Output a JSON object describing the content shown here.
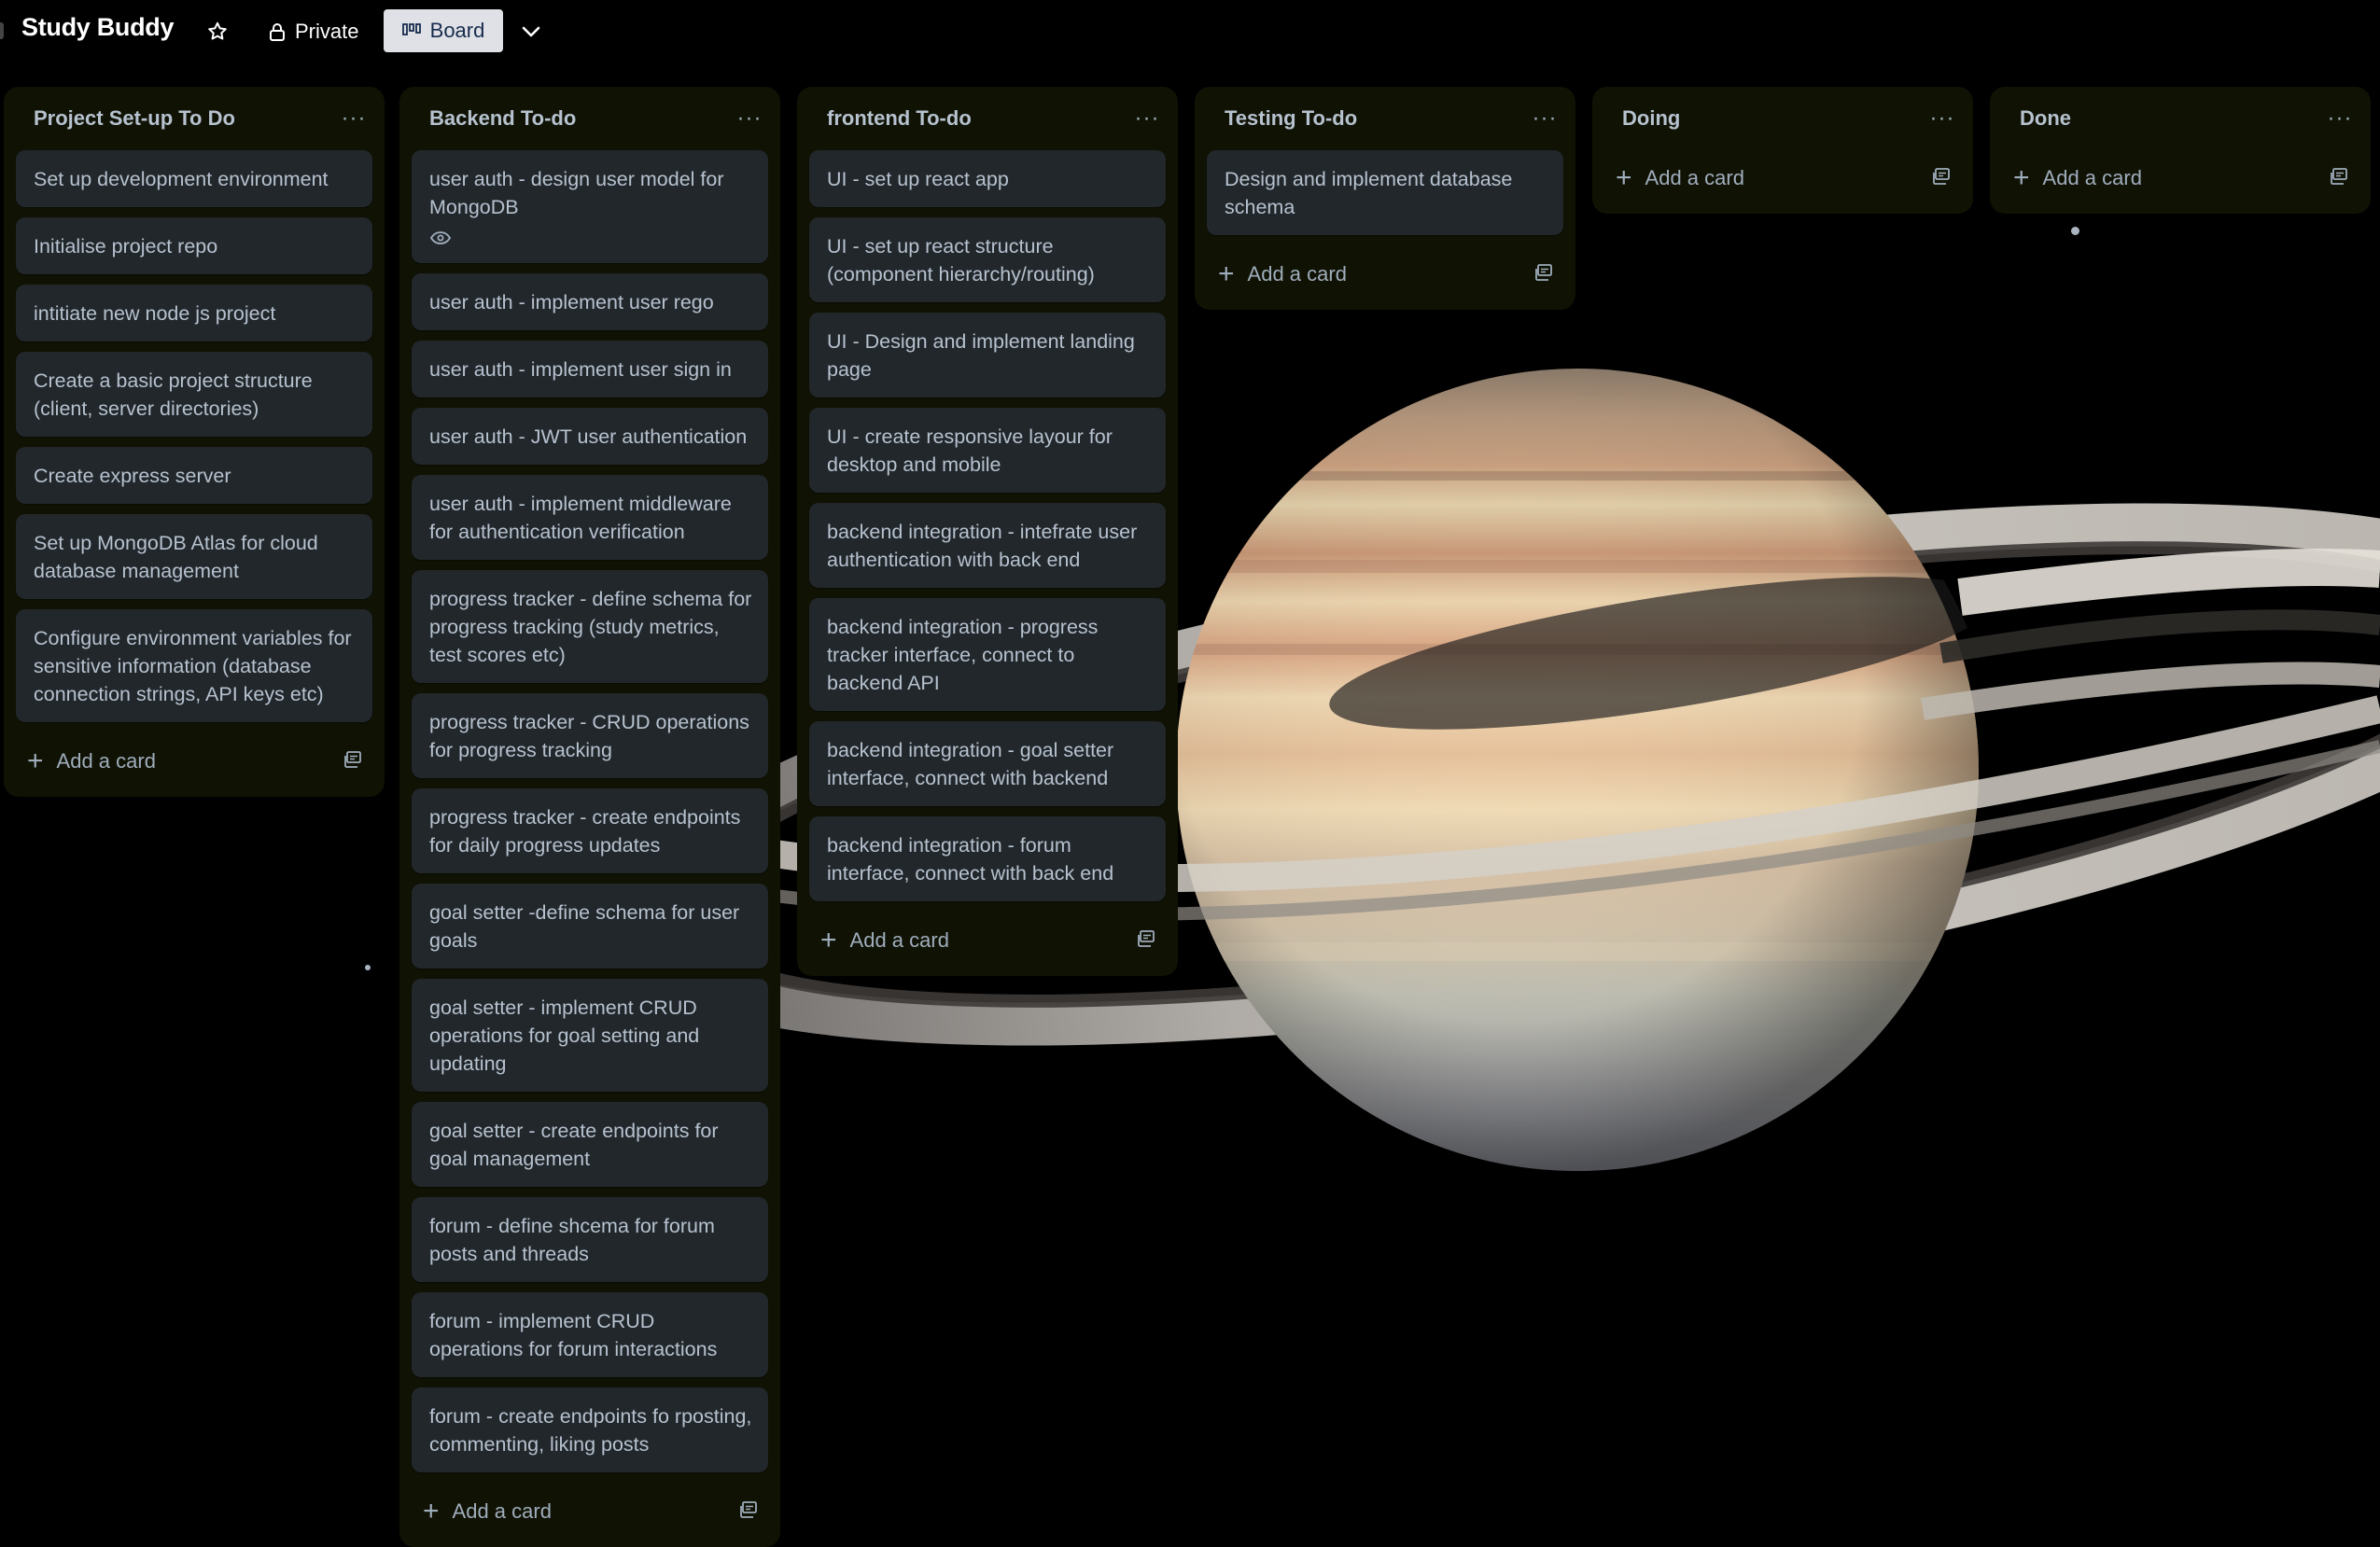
{
  "header": {
    "title": "Study Buddy",
    "visibility_label": "Private",
    "view_label": "Board"
  },
  "icons": {
    "star": "star-icon",
    "lock": "lock-icon",
    "board": "board-icon",
    "chevron": "chevron-down-icon",
    "menu": "more-icon",
    "plus": "plus-icon",
    "template": "card-template-icon",
    "watch": "eye-icon"
  },
  "colors": {
    "list_bg": "#101204",
    "card_bg": "#22272b",
    "text": "#b6c2cf",
    "board_button_bg": "#dfe1e6"
  },
  "add_card_label": "Add a card",
  "menu_glyph": "···",
  "lists": [
    {
      "title": "Project Set-up To Do",
      "cards": [
        "Set up development environment",
        "Initialise project repo",
        "intitiate new node js project",
        "Create a basic project structure (client, server directories)",
        "Create express server",
        "Set up MongoDB Atlas for cloud database management",
        "Configure environment variables for sensitive information (database connection strings, API keys etc)"
      ]
    },
    {
      "title": "Backend To-do",
      "cards": [
        "user auth - design user model for MongoDB",
        "user auth - implement user rego",
        "user auth - implement user sign in",
        "user auth - JWT user authentication",
        "user auth - implement middleware for authentication verification",
        "progress tracker - define schema for progress tracking (study metrics, test scores etc)",
        "progress tracker - CRUD operations for progress tracking",
        "progress tracker - create endpoints for daily progress updates",
        "goal setter -define schema for user goals",
        "goal setter - implement CRUD operations for goal setting and updating",
        "goal setter - create endpoints for goal management",
        "forum - define shcema for forum posts and threads",
        "forum - implement CRUD operations for forum interactions",
        "forum - create endpoints fo rposting, commenting, liking posts"
      ]
    },
    {
      "title": "frontend To-do",
      "cards": [
        "UI - set up react app",
        "UI - set up react structure (component hierarchy/routing)",
        "UI - Design and implement landing page",
        "UI - create responsive layour for desktop and mobile",
        "backend integration - intefrate user authentication with back end",
        "backend integration - progress tracker interface, connect to backend API",
        "backend integration - goal setter interface, connect with backend",
        "backend integration - forum interface, connect with back end"
      ]
    },
    {
      "title": "Testing To-do",
      "cards": [
        "Design and implement database schema"
      ]
    },
    {
      "title": "Doing",
      "cards": []
    },
    {
      "title": "Done",
      "cards": []
    }
  ]
}
